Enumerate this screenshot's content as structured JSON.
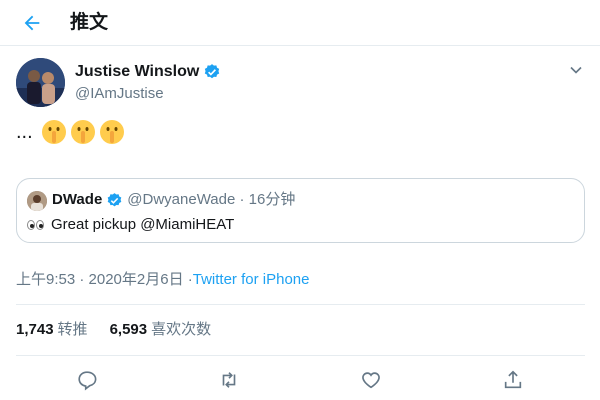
{
  "header": {
    "title": "推文",
    "back_icon": "arrow-left-icon"
  },
  "tweet": {
    "author_name": "Justise Winslow",
    "author_handle": "@IAmJustise",
    "text_prefix": "...",
    "emoji": [
      "shushing-face",
      "shushing-face",
      "shushing-face"
    ],
    "timestamp": "上午9:53 · 2020年2月6日 · ",
    "source": "Twitter for iPhone"
  },
  "quoted": {
    "author_name": "DWade",
    "author_handle": "@DwyaneWade · 16分钟",
    "text": "Great pickup @MiamiHEAT"
  },
  "stats": {
    "retweets_count": "1,743",
    "retweets_label": "转推",
    "likes_count": "6,593",
    "likes_label": "喜欢次数"
  },
  "actions": [
    "reply-icon",
    "retweet-icon",
    "like-icon",
    "share-icon"
  ],
  "colors": {
    "accent": "#1da1f2",
    "muted": "#657786",
    "text": "#14171a",
    "border": "#e6ecf0"
  }
}
